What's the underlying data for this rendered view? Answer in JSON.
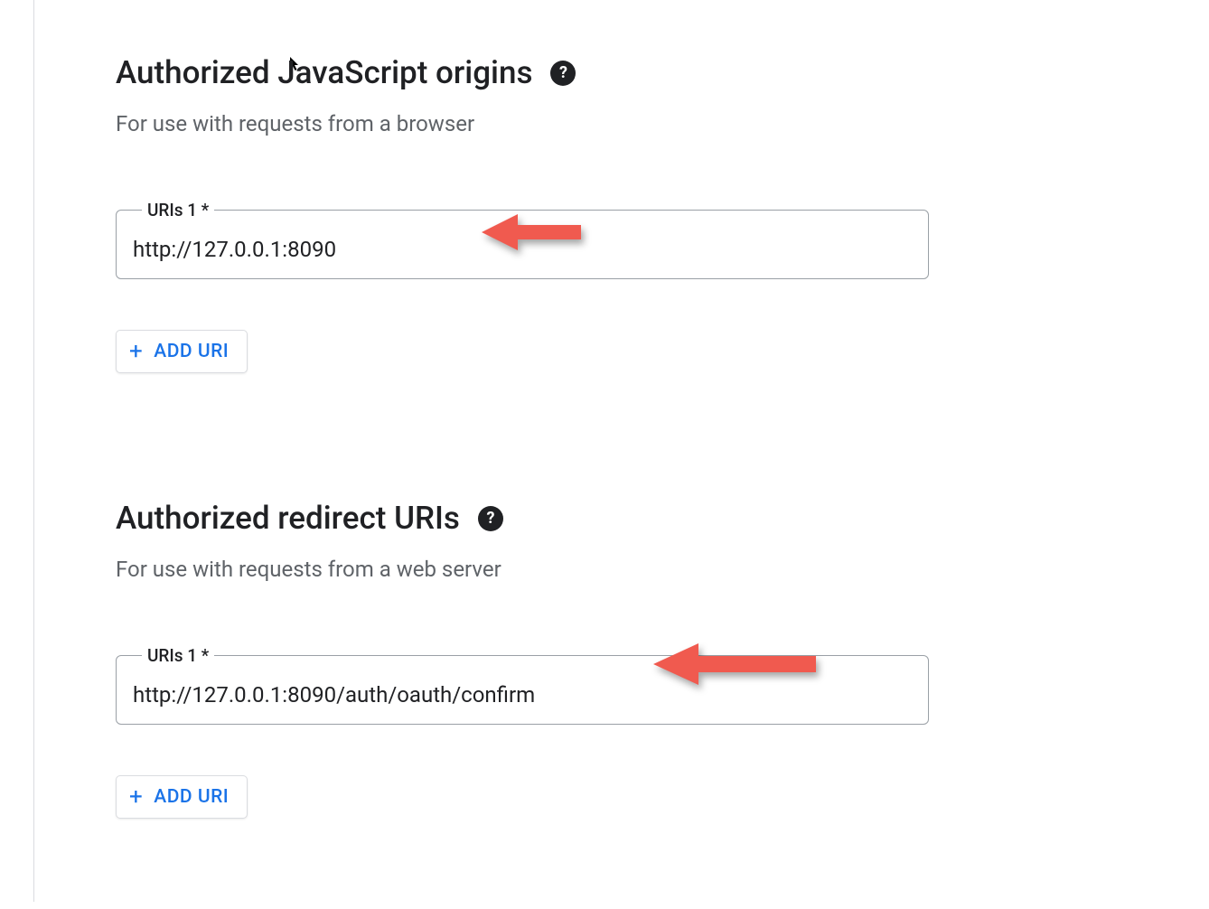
{
  "sections": {
    "js_origins": {
      "title": "Authorized JavaScript origins",
      "subtitle": "For use with requests from a browser",
      "field_label": "URIs 1 *",
      "field_value": "http://127.0.0.1:8090",
      "add_button": "ADD URI"
    },
    "redirect_uris": {
      "title": "Authorized redirect URIs",
      "subtitle": "For use with requests from a web server",
      "field_label": "URIs 1 *",
      "field_value": "http://127.0.0.1:8090/auth/oauth/confirm",
      "add_button": "ADD URI"
    }
  },
  "icons": {
    "help": "?",
    "plus": "+"
  },
  "colors": {
    "arrow": "#f05a4f",
    "accent": "#1a73e8"
  }
}
